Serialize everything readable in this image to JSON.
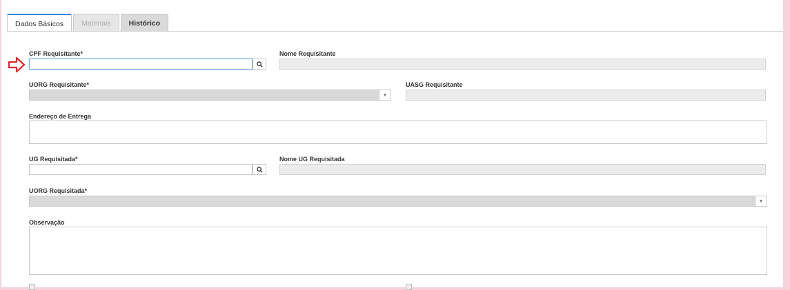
{
  "tabs": [
    {
      "label": "Dados Básicos",
      "state": "active"
    },
    {
      "label": "Materiais",
      "state": "disabled"
    },
    {
      "label": "Histórico",
      "state": "normal"
    }
  ],
  "form": {
    "cpf_requisitante": {
      "label": "CPF Requisitante*",
      "value": ""
    },
    "nome_requisitante": {
      "label": "Nome Requisitante",
      "value": ""
    },
    "uorg_requisitante": {
      "label": "UORG Requisitante*",
      "value": ""
    },
    "uasg_requisitante": {
      "label": "UASG Requisitante",
      "value": ""
    },
    "endereco_entrega": {
      "label": "Endereço de Entrega",
      "value": ""
    },
    "ug_requisitada": {
      "label": "UG Requisitada*",
      "value": ""
    },
    "nome_ug_requisitada": {
      "label": "Nome UG Requisitada",
      "value": ""
    },
    "uorg_requisitada": {
      "label": "UORG Requisitada*",
      "value": ""
    },
    "observacao": {
      "label": "Observação",
      "value": ""
    }
  },
  "icons": {
    "search": "search-icon",
    "dropdown": "chevron-down-icon",
    "pointer": "arrow-right-icon"
  },
  "colors": {
    "background": "#f4d3dc",
    "active_tab_accent": "#3b7dd8",
    "arrow": "#e0262f",
    "readonly_fill": "#ececec"
  }
}
